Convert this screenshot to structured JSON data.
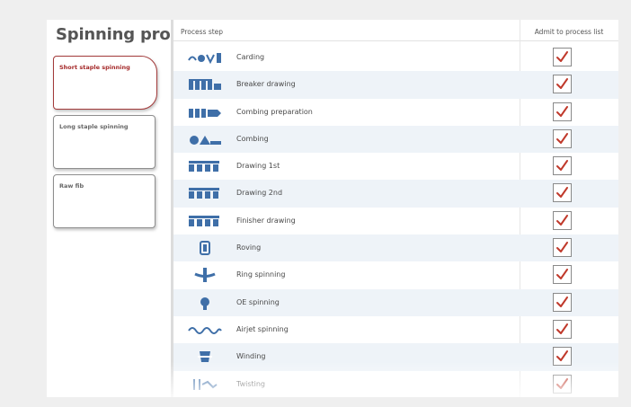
{
  "left": {
    "title": "Spinning process",
    "cards": [
      {
        "label": "Short staple spinning",
        "active": true
      },
      {
        "label": "Long staple spinning",
        "active": false
      },
      {
        "label": "Raw fib",
        "active": false
      }
    ]
  },
  "table": {
    "header_step": "Process step",
    "header_admit": "Admit to process list",
    "rows": [
      {
        "label": "Carding",
        "icon": "carding-icon",
        "checked": true
      },
      {
        "label": "Breaker drawing",
        "icon": "breaker-drawing-icon",
        "checked": true
      },
      {
        "label": "Combing preparation",
        "icon": "combing-preparation-icon",
        "checked": true
      },
      {
        "label": "Combing",
        "icon": "combing-icon",
        "checked": true
      },
      {
        "label": "Drawing 1st",
        "icon": "drawing-1st-icon",
        "checked": true
      },
      {
        "label": "Drawing 2nd",
        "icon": "drawing-2nd-icon",
        "checked": true
      },
      {
        "label": "Finisher drawing",
        "icon": "finisher-drawing-icon",
        "checked": true
      },
      {
        "label": "Roving",
        "icon": "roving-icon",
        "checked": true
      },
      {
        "label": "Ring spinning",
        "icon": "ring-spinning-icon",
        "checked": true
      },
      {
        "label": "OE spinning",
        "icon": "oe-spinning-icon",
        "checked": true
      },
      {
        "label": "Airjet spinning",
        "icon": "airjet-spinning-icon",
        "checked": true
      },
      {
        "label": "Winding",
        "icon": "winding-icon",
        "checked": true
      },
      {
        "label": "Twisting",
        "icon": "twisting-icon",
        "checked": true
      }
    ]
  },
  "colors": {
    "accent": "#a33a3a",
    "icon": "#3f6fa8",
    "check": "#c0392b",
    "row_alt": "#eef3f8"
  }
}
